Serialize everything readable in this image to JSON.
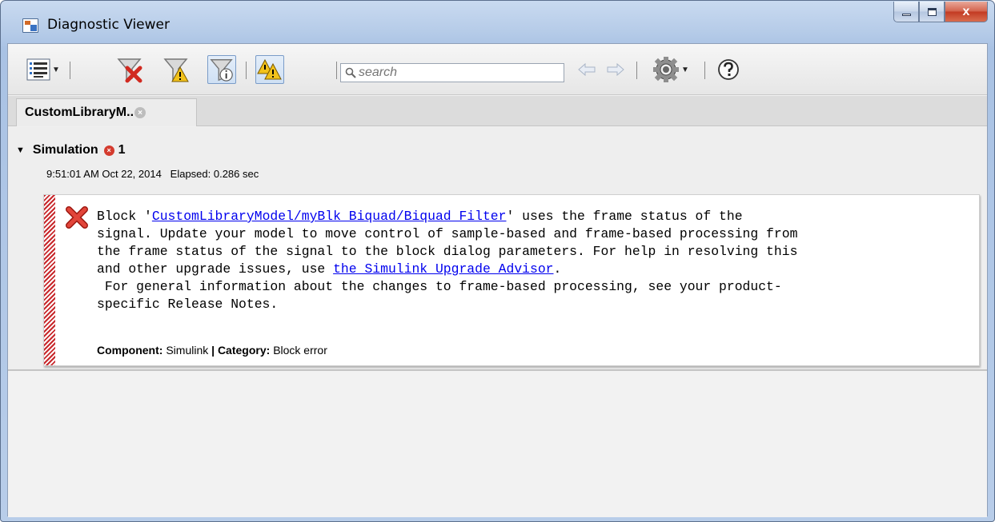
{
  "window": {
    "title": "Diagnostic Viewer",
    "controls": {
      "minimize": "minimize",
      "maximize": "maximize",
      "close": "x"
    }
  },
  "toolbar": {
    "items": [
      {
        "icon": "list-view-icon",
        "has_dropdown": true
      },
      {
        "icon": "filter-errors-icon",
        "has_dropdown": false
      },
      {
        "icon": "filter-warnings-icon",
        "has_dropdown": false
      },
      {
        "icon": "filter-info-icon",
        "has_dropdown": false,
        "toggled": true
      },
      {
        "icon": "highlight-warnings-icon",
        "has_dropdown": false,
        "toggled": true
      },
      {
        "icon": "nav-back-icon",
        "has_dropdown": false
      },
      {
        "icon": "nav-forward-icon",
        "has_dropdown": false
      },
      {
        "icon": "gear-icon",
        "has_dropdown": true
      },
      {
        "icon": "help-icon",
        "has_dropdown": false
      }
    ],
    "search": {
      "placeholder": "search",
      "value": ""
    }
  },
  "tabs": [
    {
      "label": "CustomLibraryM..",
      "closable": true
    }
  ],
  "section": {
    "title": "Simulation",
    "error_count": "1",
    "timestamp": "9:51:01 AM Oct 22, 2014   Elapsed: 0.286 sec"
  },
  "message": {
    "severity": "error",
    "line1_prefix": "Block '",
    "link1": "CustomLibraryModel/myBlk_Biquad/Biquad Filter",
    "line1_suffix": "' uses the frame status of the",
    "line2": "signal. Update your model to move control of sample-based and frame-based processing from",
    "line3": "the frame status of the signal to the block dialog parameters. For help in resolving this",
    "line4_prefix": "and other upgrade issues, use ",
    "link2": "the Simulink Upgrade Advisor",
    "line4_suffix": ".",
    "line5": " For general information about the changes to frame-based processing, see your product-",
    "line6": "specific Release Notes.",
    "component_label": "Component:",
    "component_value": "Simulink",
    "separator": "|",
    "category_label": "Category:",
    "category_value": "Block error"
  },
  "colors": {
    "error_red": "#c8282c",
    "link_blue": "#0000ee",
    "toggle_border": "#7a9cc8"
  }
}
